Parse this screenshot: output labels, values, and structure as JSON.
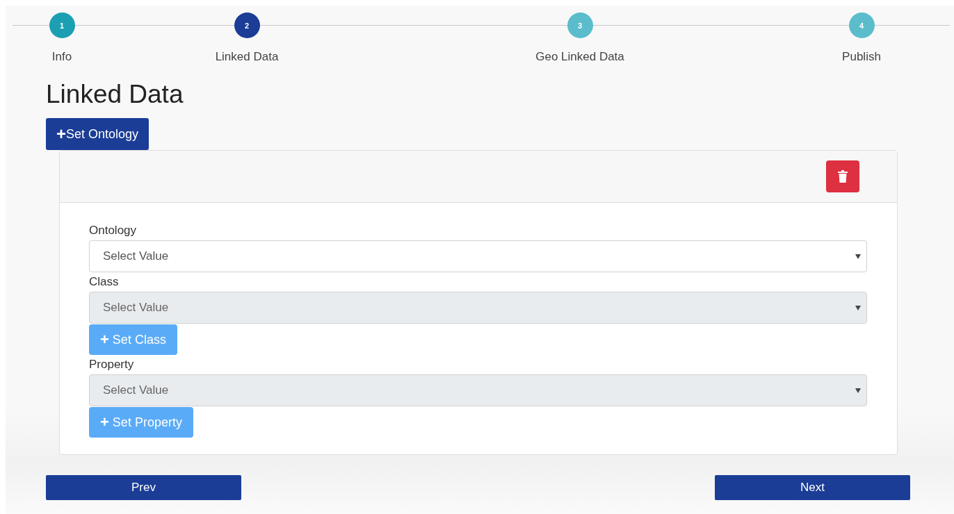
{
  "steps": [
    {
      "number": "1",
      "label": "Info",
      "selected": false,
      "completed": true
    },
    {
      "number": "2",
      "label": "Linked Data",
      "selected": true,
      "completed": false
    },
    {
      "number": "3",
      "label": "Geo Linked Data",
      "selected": false,
      "completed": false
    },
    {
      "number": "4",
      "label": "Publish",
      "selected": false,
      "completed": false
    }
  ],
  "page_title": "Linked Data",
  "set_ontology_button": {
    "icon": "+",
    "label": "Set Ontology"
  },
  "card": {
    "fields": [
      {
        "label": "Ontology",
        "placeholder": "Select Value",
        "disabled": false
      },
      {
        "label": "Class",
        "placeholder": "Select Value",
        "disabled": true,
        "button": {
          "icon": "+",
          "label": "Set Class",
          "disabled": true
        }
      },
      {
        "label": "Property",
        "placeholder": "Select Value",
        "disabled": true,
        "button": {
          "icon": "+",
          "label": "Set Property",
          "disabled": true
        }
      }
    ]
  },
  "nav_buttons": [
    {
      "label": "Prev"
    },
    {
      "label": "Next"
    }
  ]
}
